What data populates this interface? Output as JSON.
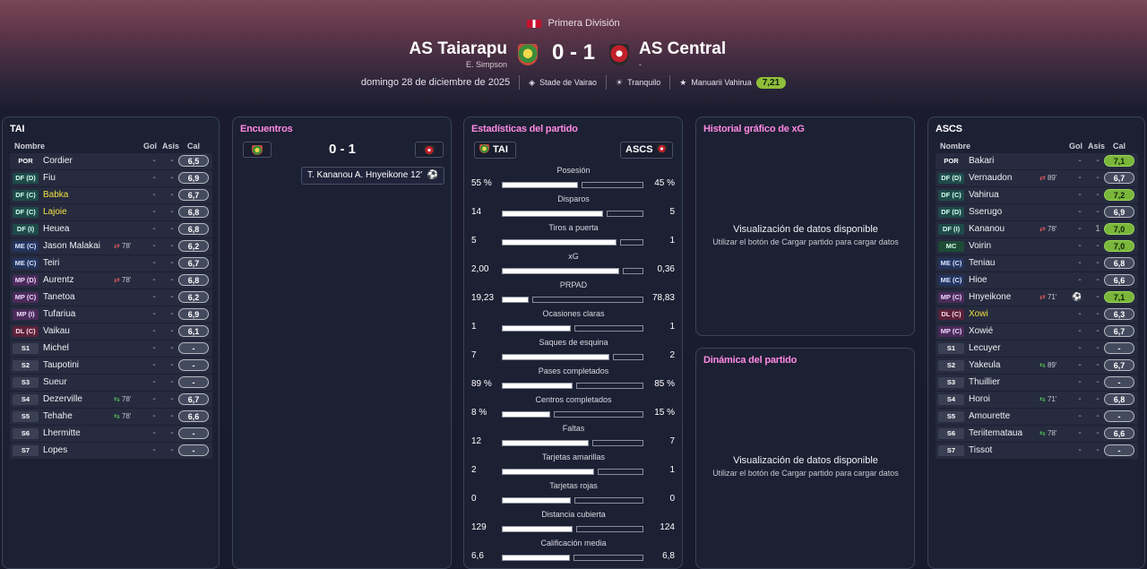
{
  "header": {
    "competition": "Primera División",
    "home_team": "AS Taiarapu",
    "home_coach": "E. Simpson",
    "away_team": "AS Central",
    "away_coach": "-",
    "score": "0 - 1",
    "date": "domingo 28 de diciembre de 2025",
    "stadium": "Stade de Vairao",
    "weather": "Tranquilo",
    "mvp_name": "Manuarii Vahirua",
    "mvp_rating": "7,21"
  },
  "home_lineup": {
    "title": "TAI",
    "col_name": "Nombre",
    "col_gol": "Gol",
    "col_asis": "Asis",
    "col_cal": "Cal",
    "players": [
      {
        "pos": "POR",
        "cls": "por",
        "name": "Cordier",
        "sub": "",
        "dir": "",
        "gol": "-",
        "asis": "-",
        "cal": "6,5",
        "hl": false,
        "yellow": false
      },
      {
        "pos": "DF (D)",
        "cls": "df",
        "name": "Fiu",
        "sub": "",
        "dir": "",
        "gol": "-",
        "asis": "-",
        "cal": "6,9",
        "hl": false,
        "yellow": false
      },
      {
        "pos": "DF (C)",
        "cls": "df",
        "name": "Babka",
        "sub": "",
        "dir": "",
        "gol": "-",
        "asis": "-",
        "cal": "6,7",
        "hl": false,
        "yellow": true
      },
      {
        "pos": "DF (C)",
        "cls": "df",
        "name": "Lajoie",
        "sub": "",
        "dir": "",
        "gol": "-",
        "asis": "-",
        "cal": "6,8",
        "hl": false,
        "yellow": true
      },
      {
        "pos": "DF (I)",
        "cls": "df",
        "name": "Heuea",
        "sub": "",
        "dir": "",
        "gol": "-",
        "asis": "-",
        "cal": "6,8",
        "hl": false,
        "yellow": false
      },
      {
        "pos": "ME (C)",
        "cls": "me",
        "name": "Jason Malakai",
        "sub": "78'",
        "dir": "out",
        "gol": "-",
        "asis": "-",
        "cal": "6,2",
        "hl": false,
        "yellow": false
      },
      {
        "pos": "ME (C)",
        "cls": "me",
        "name": "Teiri",
        "sub": "",
        "dir": "",
        "gol": "-",
        "asis": "-",
        "cal": "6,7",
        "hl": false,
        "yellow": false
      },
      {
        "pos": "MP (D)",
        "cls": "mp",
        "name": "Aurentz",
        "sub": "78'",
        "dir": "out",
        "gol": "-",
        "asis": "-",
        "cal": "6,8",
        "hl": false,
        "yellow": false
      },
      {
        "pos": "MP (C)",
        "cls": "mp",
        "name": "Tanetoa",
        "sub": "",
        "dir": "",
        "gol": "-",
        "asis": "-",
        "cal": "6,2",
        "hl": false,
        "yellow": false
      },
      {
        "pos": "MP (I)",
        "cls": "mp",
        "name": "Tufariua",
        "sub": "",
        "dir": "",
        "gol": "-",
        "asis": "-",
        "cal": "6,9",
        "hl": false,
        "yellow": false
      },
      {
        "pos": "DL (C)",
        "cls": "dl",
        "name": "Vaikau",
        "sub": "",
        "dir": "",
        "gol": "-",
        "asis": "-",
        "cal": "6,1",
        "hl": false,
        "yellow": false
      },
      {
        "pos": "S1",
        "cls": "s",
        "name": "Michel",
        "sub": "",
        "dir": "",
        "gol": "-",
        "asis": "-",
        "cal": "-",
        "hl": false,
        "yellow": false
      },
      {
        "pos": "S2",
        "cls": "s",
        "name": "Taupotini",
        "sub": "",
        "dir": "",
        "gol": "-",
        "asis": "-",
        "cal": "-",
        "hl": false,
        "yellow": false
      },
      {
        "pos": "S3",
        "cls": "s",
        "name": "Sueur",
        "sub": "",
        "dir": "",
        "gol": "-",
        "asis": "-",
        "cal": "-",
        "hl": false,
        "yellow": false
      },
      {
        "pos": "S4",
        "cls": "s",
        "name": "Dezerville",
        "sub": "78'",
        "dir": "in",
        "gol": "-",
        "asis": "-",
        "cal": "6,7",
        "hl": false,
        "yellow": false
      },
      {
        "pos": "S5",
        "cls": "s",
        "name": "Tehahe",
        "sub": "78'",
        "dir": "in",
        "gol": "-",
        "asis": "-",
        "cal": "6,6",
        "hl": false,
        "yellow": false
      },
      {
        "pos": "S6",
        "cls": "s",
        "name": "Lhermitte",
        "sub": "",
        "dir": "",
        "gol": "-",
        "asis": "-",
        "cal": "-",
        "hl": false,
        "yellow": false
      },
      {
        "pos": "S7",
        "cls": "s",
        "name": "Lopes",
        "sub": "",
        "dir": "",
        "gol": "-",
        "asis": "-",
        "cal": "-",
        "hl": false,
        "yellow": false
      }
    ]
  },
  "away_lineup": {
    "title": "ASCS",
    "col_name": "Nombre",
    "col_gol": "Gol",
    "col_asis": "Asis",
    "col_cal": "Cal",
    "players": [
      {
        "pos": "POR",
        "cls": "por",
        "name": "Bakari",
        "sub": "",
        "dir": "",
        "gol": "-",
        "asis": "-",
        "cal": "7,1",
        "hl": true,
        "yellow": false
      },
      {
        "pos": "DF (D)",
        "cls": "df",
        "name": "Vernaudon",
        "sub": "89'",
        "dir": "out",
        "gol": "-",
        "asis": "-",
        "cal": "6,7",
        "hl": false,
        "yellow": false
      },
      {
        "pos": "DF (C)",
        "cls": "df",
        "name": "Vahirua",
        "sub": "",
        "dir": "",
        "gol": "-",
        "asis": "-",
        "cal": "7,2",
        "hl": true,
        "yellow": false
      },
      {
        "pos": "DF (D)",
        "cls": "df",
        "name": "Sserugo",
        "sub": "",
        "dir": "",
        "gol": "-",
        "asis": "-",
        "cal": "6,9",
        "hl": false,
        "yellow": false
      },
      {
        "pos": "DF (I)",
        "cls": "df",
        "name": "Kananou",
        "sub": "78'",
        "dir": "out",
        "gol": "-",
        "asis": "1",
        "cal": "7,0",
        "hl": true,
        "yellow": false
      },
      {
        "pos": "MC",
        "cls": "mc",
        "name": "Voirin",
        "sub": "",
        "dir": "",
        "gol": "-",
        "asis": "-",
        "cal": "7,0",
        "hl": true,
        "yellow": false
      },
      {
        "pos": "ME (C)",
        "cls": "me",
        "name": "Teniau",
        "sub": "",
        "dir": "",
        "gol": "-",
        "asis": "-",
        "cal": "6,8",
        "hl": false,
        "yellow": false
      },
      {
        "pos": "ME (C)",
        "cls": "me",
        "name": "Hioe",
        "sub": "",
        "dir": "",
        "gol": "-",
        "asis": "-",
        "cal": "6,6",
        "hl": false,
        "yellow": false
      },
      {
        "pos": "MP (C)",
        "cls": "mp",
        "name": "Hnyeikone",
        "sub": "71'",
        "dir": "out",
        "gol": "ball",
        "asis": "-",
        "cal": "7,1",
        "hl": true,
        "yellow": false
      },
      {
        "pos": "DL (C)",
        "cls": "dl",
        "name": "Xowi",
        "sub": "",
        "dir": "",
        "gol": "-",
        "asis": "-",
        "cal": "6,3",
        "hl": false,
        "yellow": true
      },
      {
        "pos": "MP (C)",
        "cls": "mp",
        "name": "Xowié",
        "sub": "",
        "dir": "",
        "gol": "-",
        "asis": "-",
        "cal": "6,7",
        "hl": false,
        "yellow": false
      },
      {
        "pos": "S1",
        "cls": "s",
        "name": "Lecuyer",
        "sub": "",
        "dir": "",
        "gol": "-",
        "asis": "-",
        "cal": "-",
        "hl": false,
        "yellow": false
      },
      {
        "pos": "S2",
        "cls": "s",
        "name": "Yakeula",
        "sub": "89'",
        "dir": "in",
        "gol": "-",
        "asis": "-",
        "cal": "6,7",
        "hl": false,
        "yellow": false
      },
      {
        "pos": "S3",
        "cls": "s",
        "name": "Thuillier",
        "sub": "",
        "dir": "",
        "gol": "-",
        "asis": "-",
        "cal": "-",
        "hl": false,
        "yellow": false
      },
      {
        "pos": "S4",
        "cls": "s",
        "name": "Horoi",
        "sub": "71'",
        "dir": "in",
        "gol": "-",
        "asis": "-",
        "cal": "6,8",
        "hl": false,
        "yellow": false
      },
      {
        "pos": "S5",
        "cls": "s",
        "name": "Amourette",
        "sub": "",
        "dir": "",
        "gol": "-",
        "asis": "-",
        "cal": "-",
        "hl": false,
        "yellow": false
      },
      {
        "pos": "S6",
        "cls": "s",
        "name": "Teriitemataua",
        "sub": "78'",
        "dir": "in",
        "gol": "-",
        "asis": "-",
        "cal": "6,6",
        "hl": false,
        "yellow": false
      },
      {
        "pos": "S7",
        "cls": "s",
        "name": "Tissot",
        "sub": "",
        "dir": "",
        "gol": "-",
        "asis": "-",
        "cal": "-",
        "hl": false,
        "yellow": false
      }
    ]
  },
  "encounters": {
    "title": "Encuentros",
    "score": "0 - 1",
    "goal_text": "T. Kananou  A. Hnyeikone 12'"
  },
  "stats": {
    "title": "Estadísticas del partido",
    "home_abbr": "TAI",
    "away_abbr": "ASCS",
    "items": [
      {
        "label": "Posesión",
        "home": "55 %",
        "away": "45 %",
        "h": 55,
        "a": 45
      },
      {
        "label": "Disparos",
        "home": "14",
        "away": "5",
        "h": 14,
        "a": 5
      },
      {
        "label": "Tiros a puerta",
        "home": "5",
        "away": "1",
        "h": 5,
        "a": 1
      },
      {
        "label": "xG",
        "home": "2,00",
        "away": "0,36",
        "h": 2.0,
        "a": 0.36
      },
      {
        "label": "PRPAD",
        "home": "19,23",
        "away": "78,83",
        "h": 19.23,
        "a": 78.83
      },
      {
        "label": "Ocasiones claras",
        "home": "1",
        "away": "1",
        "h": 1,
        "a": 1
      },
      {
        "label": "Saques de esquina",
        "home": "7",
        "away": "2",
        "h": 7,
        "a": 2
      },
      {
        "label": "Pases completados",
        "home": "89 %",
        "away": "85 %",
        "h": 89,
        "a": 85
      },
      {
        "label": "Centros completados",
        "home": "8 %",
        "away": "15 %",
        "h": 8,
        "a": 15
      },
      {
        "label": "Faltas",
        "home": "12",
        "away": "7",
        "h": 12,
        "a": 7
      },
      {
        "label": "Tarjetas amarillas",
        "home": "2",
        "away": "1",
        "h": 2,
        "a": 1
      },
      {
        "label": "Tarjetas rojas",
        "home": "0",
        "away": "0",
        "h": 0,
        "a": 0
      },
      {
        "label": "Distancia cubierta",
        "home": "129",
        "away": "124",
        "h": 129,
        "a": 124
      },
      {
        "label": "Calificación media",
        "home": "6,6",
        "away": "6,8",
        "h": 6.6,
        "a": 6.8
      }
    ]
  },
  "xg_panel": {
    "title": "Historial gráfico de xG",
    "msg": "Visualización de datos disponible",
    "sub": "Utilizar el botón de Cargar partido para cargar datos"
  },
  "dyn_panel": {
    "title": "Dinámica del partido",
    "msg": "Visualización de datos disponible",
    "sub": "Utilizar el botón de Cargar partido para cargar datos"
  },
  "colors": {
    "accent_title": "#ff8ae2",
    "rating_green": "#7ab63a"
  }
}
